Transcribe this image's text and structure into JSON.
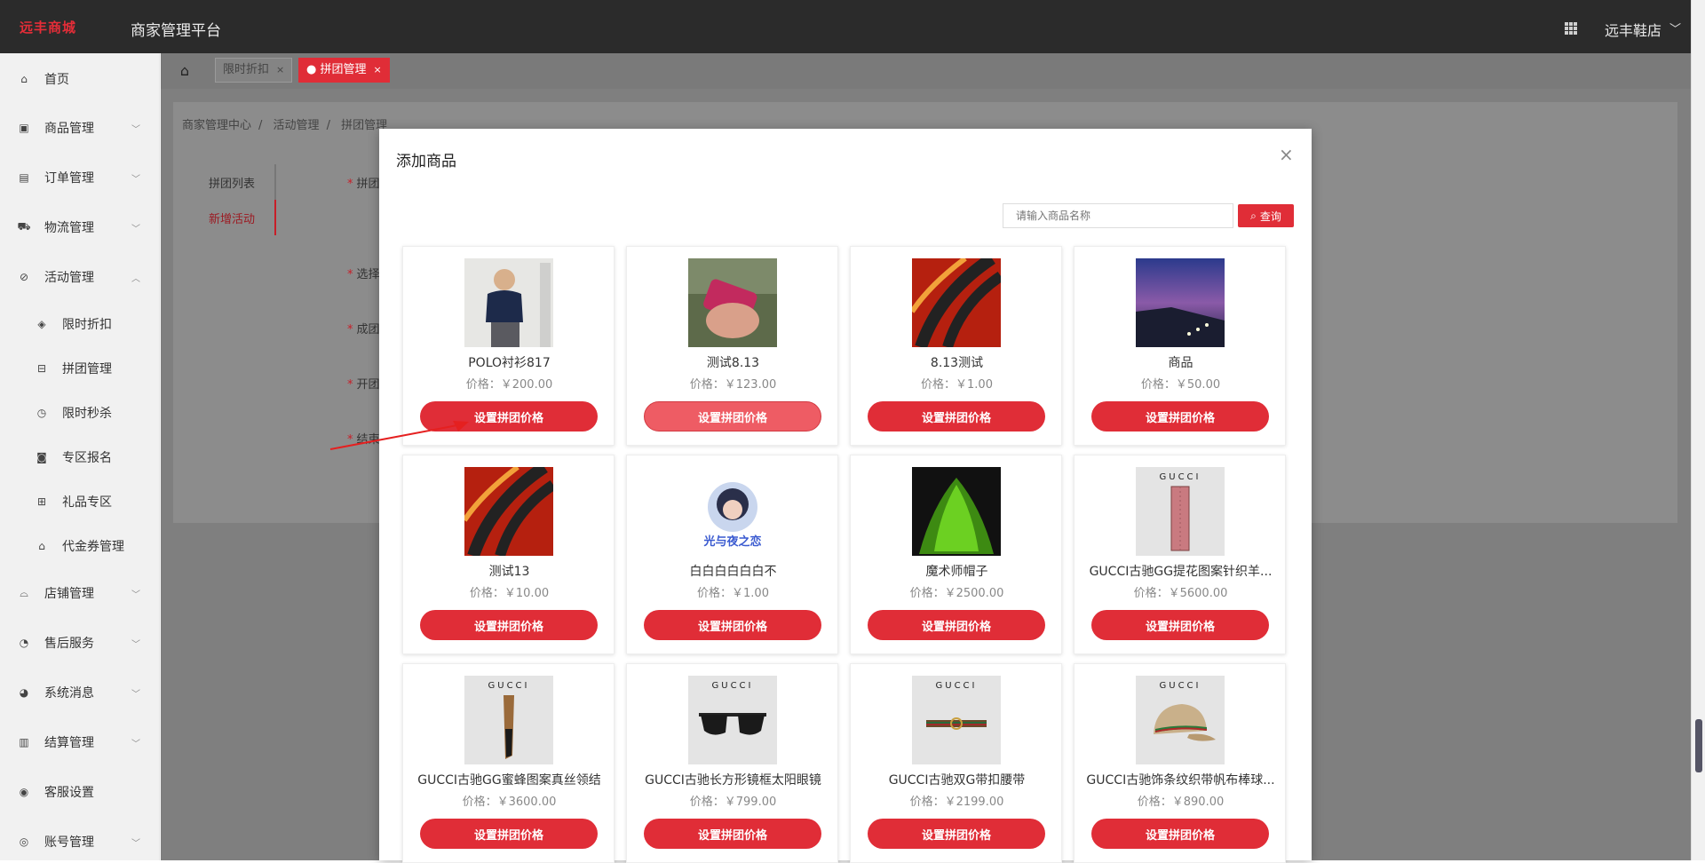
{
  "topbar": {
    "logo": "远丰商城",
    "platform": "商家管理平台",
    "store_name": "远丰鞋店"
  },
  "sidebar": {
    "items": [
      {
        "label": "首页",
        "icon": "home-icon"
      },
      {
        "label": "商品管理",
        "icon": "goods-icon"
      },
      {
        "label": "订单管理",
        "icon": "order-icon"
      },
      {
        "label": "物流管理",
        "icon": "truck-icon"
      },
      {
        "label": "活动管理",
        "icon": "tag-icon"
      },
      {
        "label": "限时折扣",
        "icon": "discount-icon"
      },
      {
        "label": "拼团管理",
        "icon": "group-icon"
      },
      {
        "label": "限时秒杀",
        "icon": "clock-icon"
      },
      {
        "label": "专区报名",
        "icon": "signup-icon"
      },
      {
        "label": "礼品专区",
        "icon": "gift-icon"
      },
      {
        "label": "代金券管理",
        "icon": "coupon-icon"
      },
      {
        "label": "店铺管理",
        "icon": "store-icon"
      },
      {
        "label": "售后服务",
        "icon": "service-icon"
      },
      {
        "label": "系统消息",
        "icon": "message-icon"
      },
      {
        "label": "结算管理",
        "icon": "settle-icon"
      },
      {
        "label": "客服设置",
        "icon": "support-icon"
      },
      {
        "label": "账号管理",
        "icon": "account-icon"
      }
    ]
  },
  "tabs": [
    {
      "label": "限时折扣"
    },
    {
      "label": "拼团管理"
    }
  ],
  "breadcrumb": [
    "商家管理中心",
    "活动管理",
    "拼团管理"
  ],
  "left_tabs": [
    "拼团列表",
    "新增活动"
  ],
  "form_labels": [
    "拼团",
    "选择",
    "成团",
    "开团",
    "结束"
  ],
  "modal": {
    "title": "添加商品",
    "search_placeholder": "请输入商品名称",
    "search_button": "查询",
    "products": [
      {
        "name": "POLO衬衫817",
        "price": "价格：￥200.00",
        "button": "设置拼团价格"
      },
      {
        "name": "测试8.13",
        "price": "价格：￥123.00",
        "button": "设置拼团价格"
      },
      {
        "name": "8.13测试",
        "price": "价格：￥1.00",
        "button": "设置拼团价格"
      },
      {
        "name": "商品",
        "price": "价格：￥50.00",
        "button": "设置拼团价格"
      },
      {
        "name": "测试13",
        "price": "价格：￥10.00",
        "button": "设置拼团价格"
      },
      {
        "name": "白白白白白白不",
        "price": "价格：￥1.00",
        "button": "设置拼团价格"
      },
      {
        "name": "魔术师帽子",
        "price": "价格：￥2500.00",
        "button": "设置拼团价格"
      },
      {
        "name": "GUCCI古驰GG提花图案针织羊...",
        "price": "价格：￥5600.00",
        "button": "设置拼团价格"
      },
      {
        "name": "GUCCI古驰GG蜜蜂图案真丝领结",
        "price": "价格：￥3600.00",
        "button": "设置拼团价格"
      },
      {
        "name": "GUCCI古驰长方形镜框太阳眼镜",
        "price": "价格：￥799.00",
        "button": "设置拼团价格"
      },
      {
        "name": "GUCCI古驰双G带扣腰带",
        "price": "价格：￥2199.00",
        "button": "设置拼团价格"
      },
      {
        "name": "GUCCI古驰饰条纹织带帆布棒球...",
        "price": "价格：￥890.00",
        "button": "设置拼团价格"
      }
    ],
    "image_brand_text": "GUCCI",
    "image_caption_6": "光与夜之恋"
  },
  "colors": {
    "accent": "#e02d37",
    "topbar": "#2b2b2b",
    "overlay": "#7f7f7f"
  }
}
